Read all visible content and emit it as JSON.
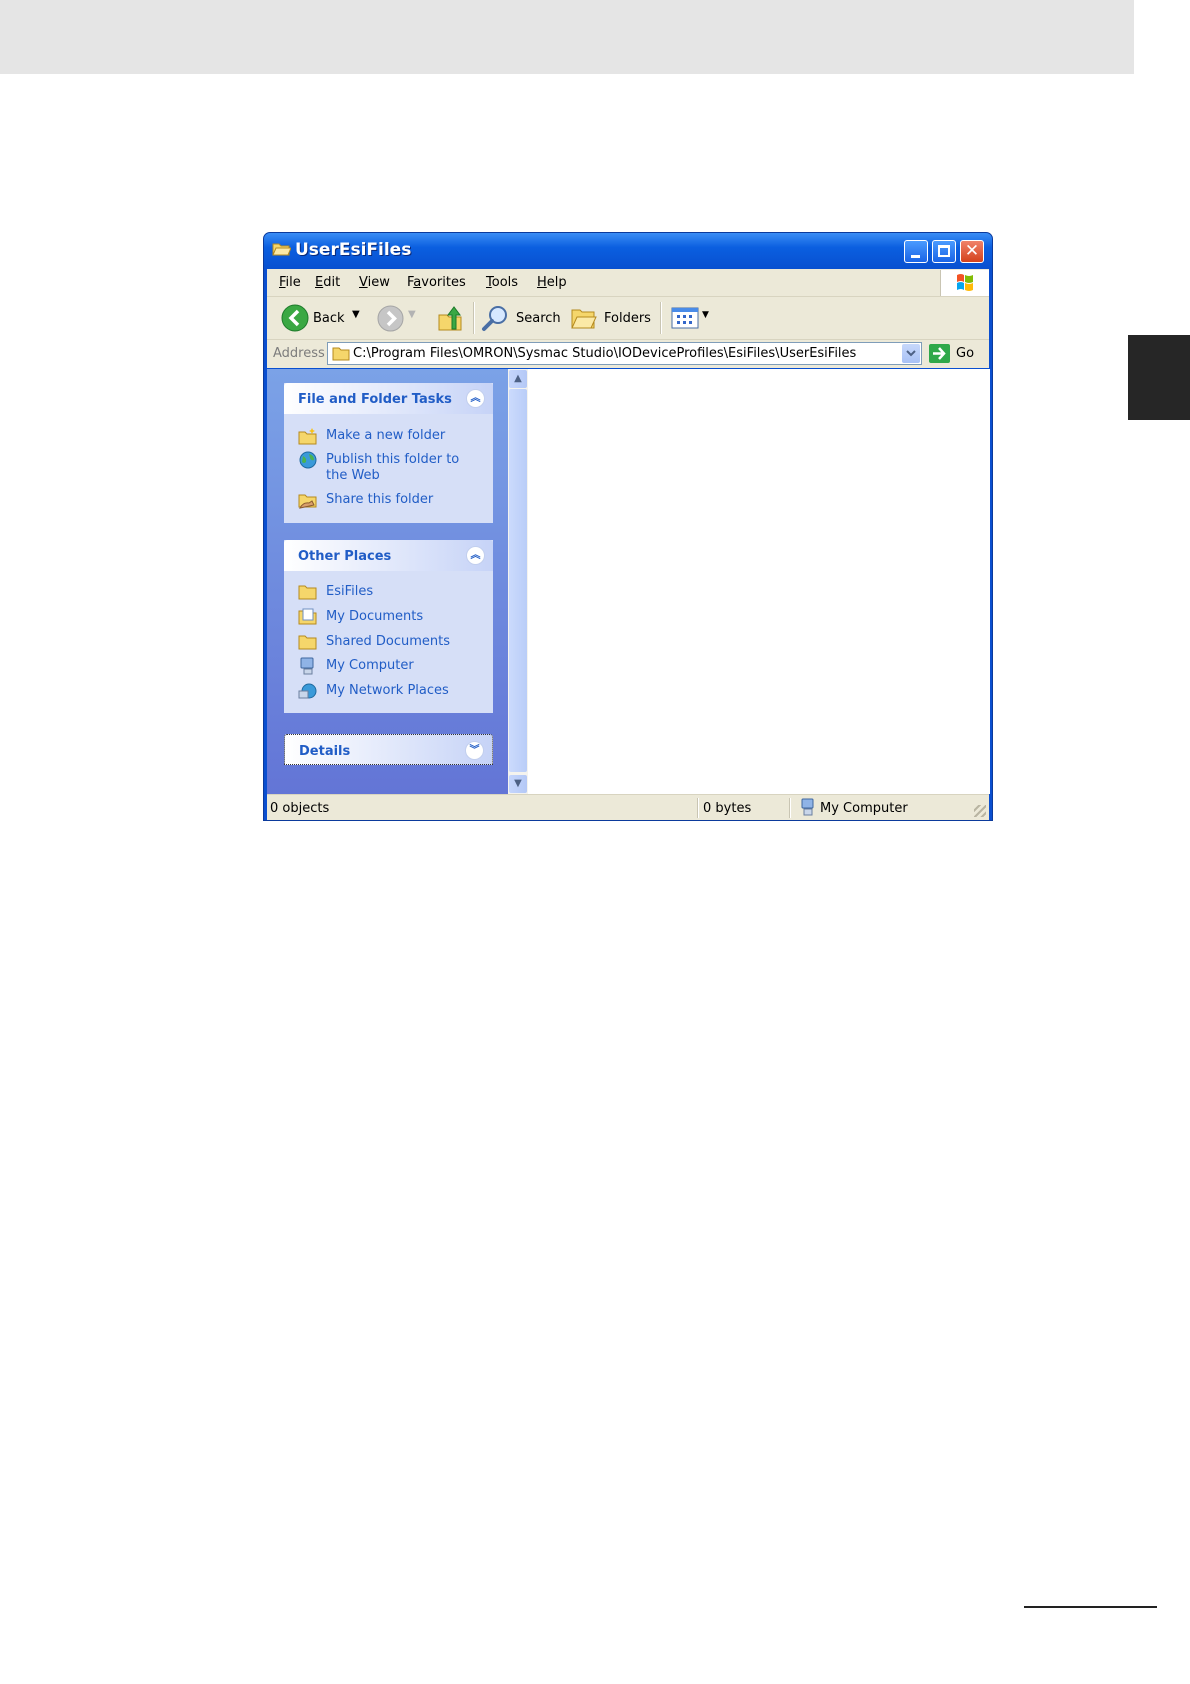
{
  "window": {
    "title": "UserEsiFiles",
    "title_icon": "folder-open-icon",
    "buttons": [
      "minimize-button",
      "maximize-button",
      "close-button"
    ]
  },
  "menu": {
    "items": [
      {
        "label": "File",
        "accel": "F"
      },
      {
        "label": "Edit",
        "accel": "E"
      },
      {
        "label": "View",
        "accel": "V"
      },
      {
        "label": "Favorites",
        "accel": "a"
      },
      {
        "label": "Tools",
        "accel": "T"
      },
      {
        "label": "Help",
        "accel": "H"
      }
    ]
  },
  "toolbar": {
    "back_label": "Back",
    "search_label": "Search",
    "folders_label": "Folders"
  },
  "address": {
    "label": "Address",
    "value": "C:\\Program Files\\OMRON\\Sysmac Studio\\IODeviceProfiles\\EsiFiles\\UserEsiFiles",
    "go_label": "Go"
  },
  "tasks_panel": {
    "title": "File and Folder Tasks",
    "items": [
      {
        "label": "Make a new folder",
        "icon": "new-folder-icon"
      },
      {
        "label": "Publish this folder to the Web",
        "icon": "globe-icon"
      },
      {
        "label": "Share this folder",
        "icon": "share-folder-icon"
      }
    ]
  },
  "places_panel": {
    "title": "Other Places",
    "items": [
      {
        "label": "EsiFiles",
        "icon": "folder-icon"
      },
      {
        "label": "My Documents",
        "icon": "documents-icon"
      },
      {
        "label": "Shared Documents",
        "icon": "folder-icon"
      },
      {
        "label": "My Computer",
        "icon": "computer-icon"
      },
      {
        "label": "My Network Places",
        "icon": "network-icon"
      }
    ]
  },
  "details_panel": {
    "title": "Details"
  },
  "status": {
    "objects": "0 objects",
    "size": "0 bytes",
    "location": "My Computer"
  },
  "colors": {
    "title_bar": "#0b5fe0",
    "task_link": "#215dc6",
    "left_pane": "#7ba2e7",
    "chrome": "#ece9d8"
  }
}
